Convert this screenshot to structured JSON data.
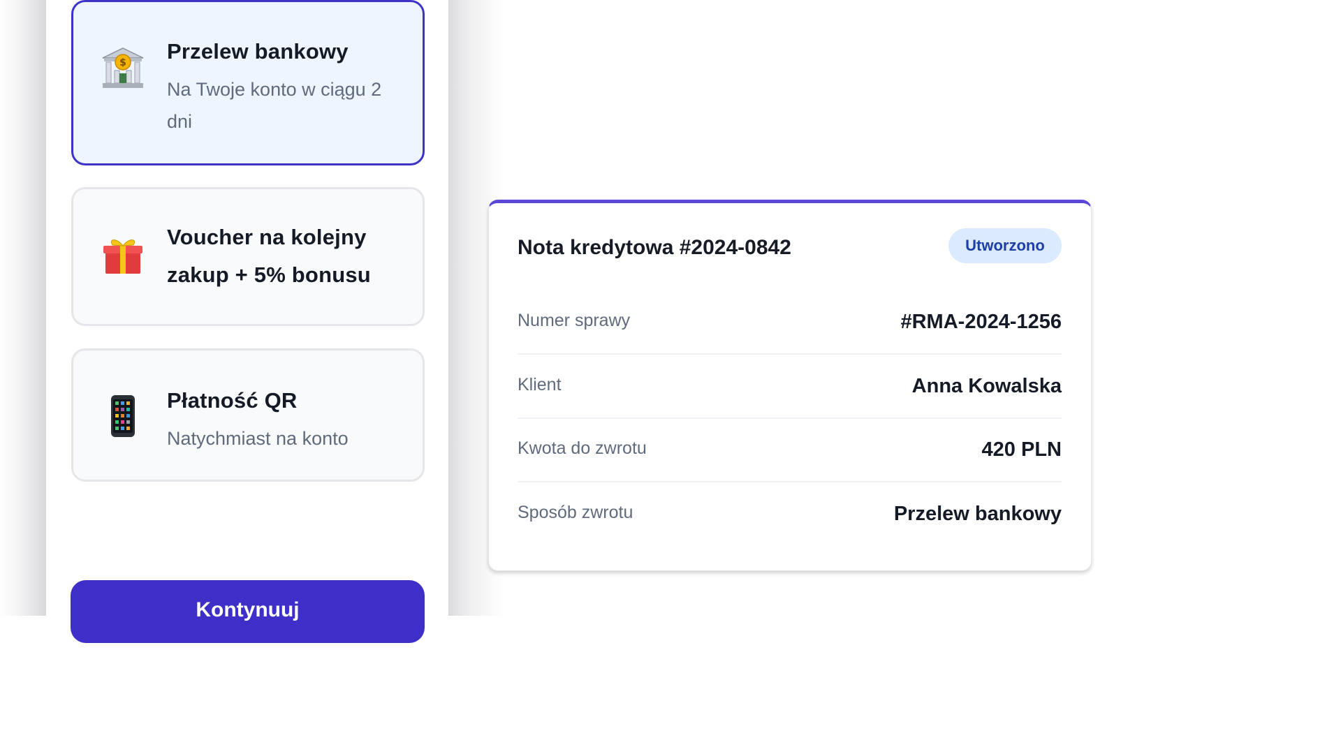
{
  "refund_options": [
    {
      "title": "Przelew bankowy",
      "subtitle": "Na Twoje konto w ciągu 2 dni",
      "icon": "bank-icon",
      "selected": true
    },
    {
      "title": "Voucher na kolejny zakup + 5% bonusu",
      "subtitle": "",
      "icon": "gift-icon",
      "selected": false
    },
    {
      "title": "Płatność QR",
      "subtitle": "Natychmiast na konto",
      "icon": "phone-icon",
      "selected": false
    }
  ],
  "continue_label": "Kontynuuj",
  "credit_note": {
    "title": "Nota kredytowa #2024-0842",
    "status": "Utworzono",
    "rows": [
      {
        "label": "Numer sprawy",
        "value": "#RMA-2024-1256"
      },
      {
        "label": "Klient",
        "value": "Anna Kowalska"
      },
      {
        "label": "Kwota do zwrotu",
        "value": "420 PLN"
      },
      {
        "label": "Sposób zwrotu",
        "value": "Przelew bankowy"
      }
    ]
  },
  "colors": {
    "accent": "#3d2fc8",
    "selected_border": "#3c34c8",
    "selected_bg": "#eef5ff",
    "badge_bg": "#dbeafe",
    "badge_text": "#1e3fa6",
    "card_top_border": "#5b47d6"
  }
}
